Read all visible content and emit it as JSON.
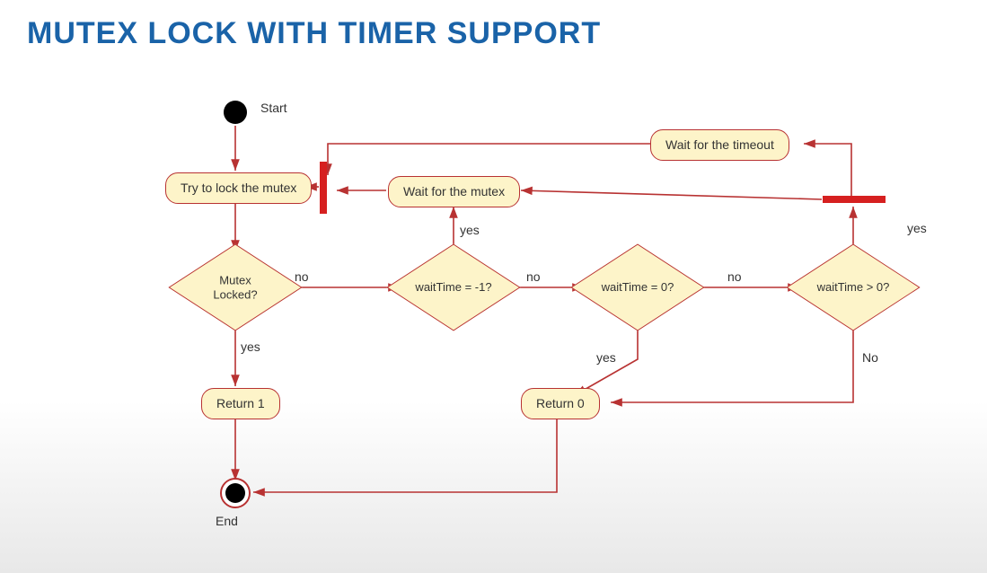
{
  "title": "MUTEX LOCK WITH TIMER SUPPORT",
  "nodes": {
    "start": "Start",
    "tryLock": "Try to lock the mutex",
    "mutexLocked": "Mutex\nLocked?",
    "return1": "Return 1",
    "end": "End",
    "waitMutex": "Wait for the mutex",
    "waitTimeNeg1": "waitTime = -1?",
    "waitTime0": "waitTime = 0?",
    "waitTimeGt0": "waitTime > 0?",
    "waitTimeout": "Wait for the timeout",
    "return0": "Return 0"
  },
  "edgeLabels": {
    "mutexLocked_no": "no",
    "mutexLocked_yes": "yes",
    "waitNeg1_yes": "yes",
    "waitNeg1_no": "no",
    "wait0_yes": "yes",
    "wait0_no": "no",
    "waitGt0_yes": "yes",
    "waitGt0_no": "No"
  },
  "colors": {
    "title": "#1a63a8",
    "nodeFill": "#fdf4c9",
    "nodeBorder": "#b83232",
    "bar": "#d62020",
    "arrow": "#b83232"
  }
}
